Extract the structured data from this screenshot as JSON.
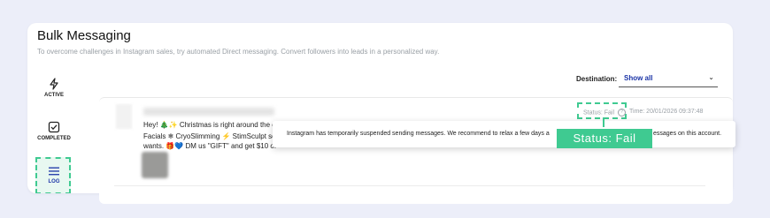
{
  "page": {
    "title": "Bulk Messaging",
    "subtitle": "To overcome challenges in Instagram sales, try automated Direct messaging. Convert followers into leads in a personalized way."
  },
  "sidebar": {
    "items": [
      {
        "label": "ACTIVE",
        "icon": "lightning-icon"
      },
      {
        "label": "COMPLETED",
        "icon": "checkbox-icon"
      },
      {
        "label": "LOG",
        "icon": "menu-icon"
      }
    ]
  },
  "filter": {
    "label": "Destination:",
    "value": "Show all"
  },
  "message": {
    "line1": "Hey! 🎄✨ Christmas is right around the c",
    "line2": "Facials ❄ CryoSlimming ⚡ StimSculpt see",
    "line3": "wants. 🎁💙 DM us \"GIFT\" and get $10 of",
    "status": "Status: Fail",
    "time": "Time: 20/01/2026 09:37:48"
  },
  "tooltip": {
    "text_left": "Instagram has temporarily suspended sending messages. We recommend to relax a few days a",
    "text_right": "essages on this account."
  },
  "callout": {
    "label": "Status: Fail"
  },
  "colors": {
    "accent": "#3fca91",
    "link": "#1a33a6",
    "background": "#eceef9"
  }
}
